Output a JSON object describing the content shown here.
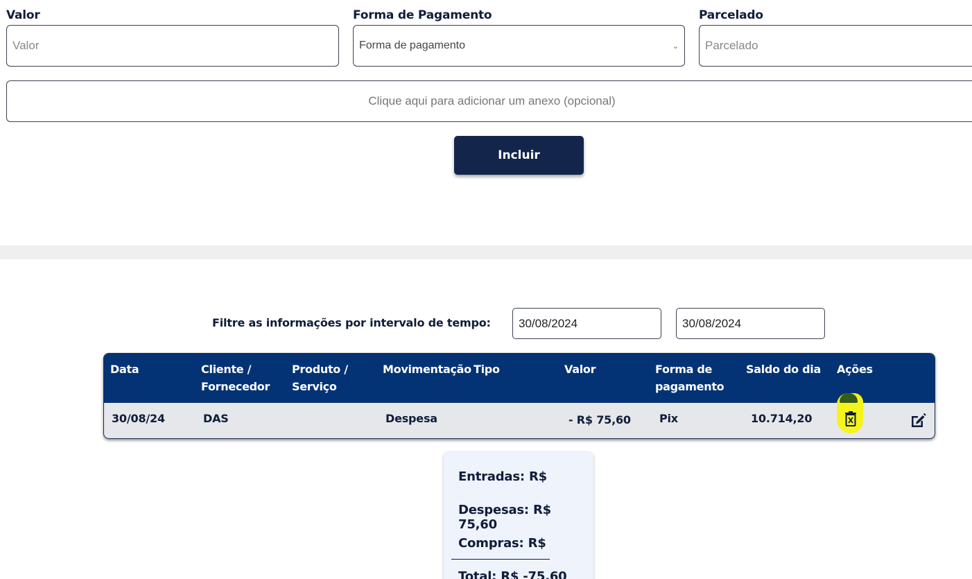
{
  "form": {
    "valor": {
      "label": "Valor",
      "placeholder": "Valor"
    },
    "forma_pagamento": {
      "label": "Forma de Pagamento",
      "placeholder": "Forma de pagamento"
    },
    "parcelado": {
      "label": "Parcelado",
      "placeholder": "Parcelado"
    },
    "anexo_text": "Clique aqui para adicionar um anexo (opcional)",
    "incluir_label": "Incluir"
  },
  "filter": {
    "label": "Filtre as informações por intervalo de tempo:",
    "start_date": "30/08/2024",
    "end_date": "30/08/2024"
  },
  "table": {
    "headers": [
      {
        "line1": "Data",
        "line2": ""
      },
      {
        "line1": "Cliente /",
        "line2": "Fornecedor"
      },
      {
        "line1": "Produto /",
        "line2": "Serviço"
      },
      {
        "line1": "Movimentação",
        "line2": ""
      },
      {
        "line1": "Tipo",
        "line2": ""
      },
      {
        "line1": "Valor",
        "line2": ""
      },
      {
        "line1": "Forma de",
        "line2": "pagamento"
      },
      {
        "line1": "Saldo do dia",
        "line2": ""
      },
      {
        "line1": "Ações",
        "line2": ""
      }
    ],
    "rows": [
      {
        "data": "30/08/24",
        "cliente": "DAS",
        "produto": "",
        "movimentacao": "Despesa",
        "tipo": "",
        "valor": "- R$ 75,60",
        "forma": "Pix",
        "saldo": "10.714,20"
      }
    ],
    "icons": {
      "delete": "trash-icon",
      "edit": "edit-icon"
    },
    "highlight_color": "#f4f41c"
  },
  "summary": {
    "entradas": "Entradas: R$",
    "despesas": "Despesas: R$ 75,60",
    "compras": "Compras: R$",
    "total": "Total: R$ -75,60"
  },
  "colors": {
    "primary_dark": "#14254b",
    "table_header": "#043375",
    "row_bg": "#e6e7ea",
    "summary_bg": "#eef3fc"
  }
}
